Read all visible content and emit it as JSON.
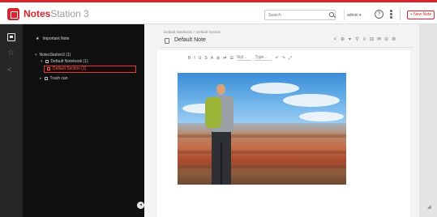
{
  "app": {
    "name_bold": "Notes",
    "name_rest": "Station 3"
  },
  "header": {
    "search_placeholder": "Search",
    "user_label": "admin ▾",
    "help_label": "?",
    "new_note_label": "+ New Note"
  },
  "sidebar": {
    "important_label": "Important Note",
    "tree": {
      "root": "NotesStation3 (1)",
      "notebook": "Default Notebook (1)",
      "section": "Default Section (1)",
      "trash": "Trash can"
    }
  },
  "note": {
    "breadcrumb": "Default Notebook  >  Default Section",
    "title": "Default Note"
  },
  "toolbar": {
    "tools": [
      "<",
      "⊕",
      "▾",
      "⚲",
      "≡",
      "⊟",
      "✉",
      "⊖",
      "⚙"
    ],
    "format": [
      "B",
      "I",
      "U",
      "S",
      "A",
      "⊞",
      "⇄",
      "☰"
    ],
    "style_label": "Styl...",
    "type_label": "Type..."
  },
  "image": {
    "alt": "hiker overlooking canyon"
  }
}
